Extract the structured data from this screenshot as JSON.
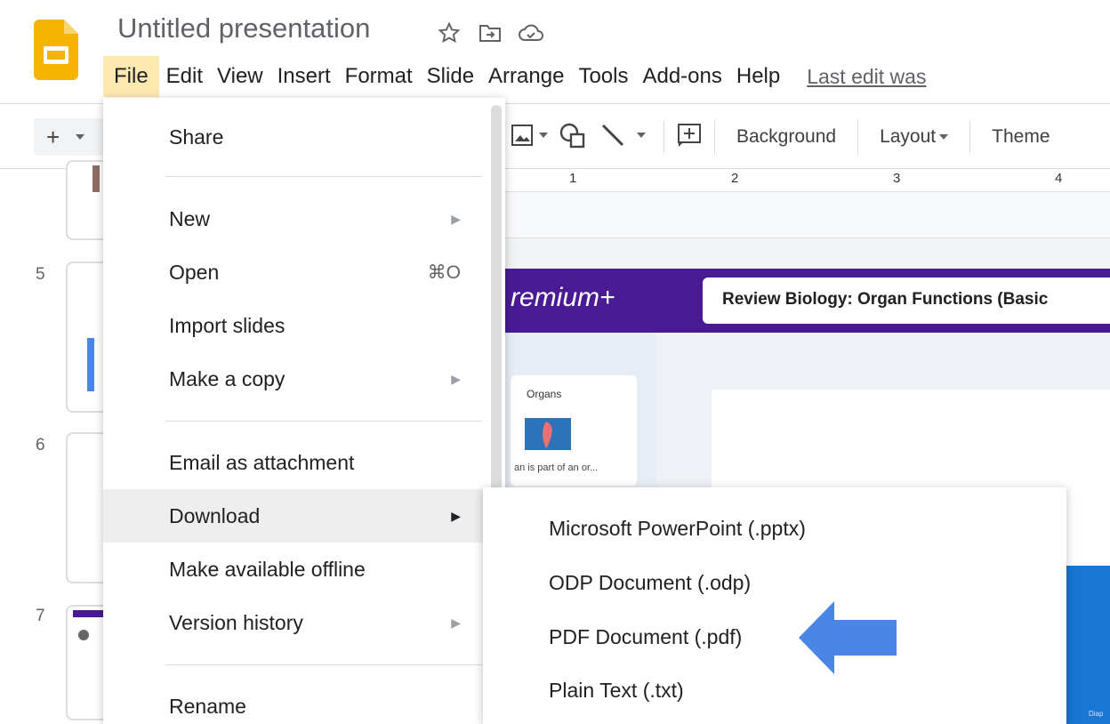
{
  "app": {
    "title": "Untitled presentation",
    "title_icons": [
      "star-icon",
      "move-to-folder-icon",
      "cloud-status-icon"
    ]
  },
  "menubar": {
    "items": [
      "File",
      "Edit",
      "View",
      "Insert",
      "Format",
      "Slide",
      "Arrange",
      "Tools",
      "Add-ons",
      "Help"
    ],
    "active": "File",
    "last_edit": "Last edit was"
  },
  "toolbar": {
    "add_symbol": "+",
    "background": "Background",
    "layout": "Layout",
    "theme": "Theme"
  },
  "ruler": {
    "marks": [
      "1",
      "2",
      "3",
      "4"
    ]
  },
  "filmstrip": {
    "slide_numbers": [
      "5",
      "6",
      "7"
    ]
  },
  "slide": {
    "brand_text": "remium+",
    "header_text": "Review Biology: Organ Functions (Basic",
    "card_title": "Organs",
    "card_caption": "an is part of an or...",
    "corner_tag": "Diap"
  },
  "file_menu": {
    "share": "Share",
    "new": "New",
    "open": "Open",
    "open_shortcut": "⌘O",
    "import_slides": "Import slides",
    "make_copy": "Make a copy",
    "email_attachment": "Email as attachment",
    "download": "Download",
    "make_offline": "Make available offline",
    "version_history": "Version history",
    "rename": "Rename"
  },
  "download_menu": {
    "pptx": "Microsoft PowerPoint (.pptx)",
    "odp": "ODP Document (.odp)",
    "pdf": "PDF Document (.pdf)",
    "txt": "Plain Text (.txt)"
  },
  "colors": {
    "brand_yellow": "#f4b400",
    "header_purple": "#4a1a94",
    "annotation_arrow": "#4a86e8",
    "menu_highlight": "#eeeeee",
    "file_active": "#fde9b0"
  }
}
